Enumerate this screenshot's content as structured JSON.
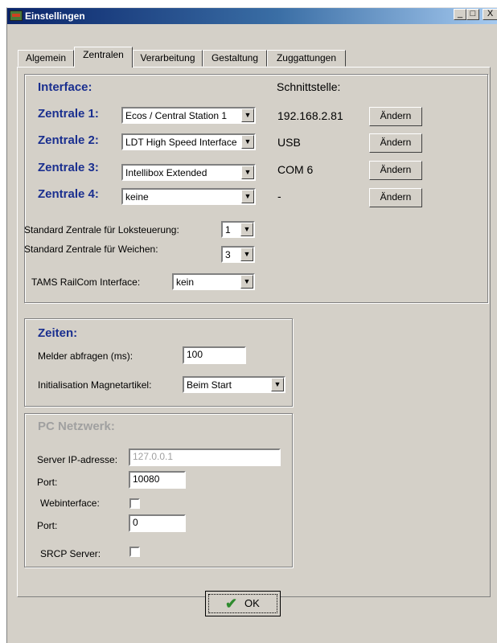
{
  "window": {
    "title": "Einstellingen",
    "minimize": "_",
    "maximize": "□",
    "close": "X"
  },
  "tabs": [
    "Algemein",
    "Zentralen",
    "Verarbeitung",
    "Gestaltung",
    "Zuggattungen"
  ],
  "interface": {
    "heading": "Interface:",
    "schnittstelle_heading": "Schnittstelle:",
    "zentralen": [
      {
        "label": "Zentrale 1:",
        "device": "Ecos / Central Station 1",
        "port": "192.168.2.81",
        "button": "Ändern"
      },
      {
        "label": "Zentrale 2:",
        "device": "LDT High Speed Interface",
        "port": "USB",
        "button": "Ändern"
      },
      {
        "label": "Zentrale 3:",
        "device": "Intellibox Extended",
        "port": "COM 6",
        "button": "Ändern"
      },
      {
        "label": "Zentrale 4:",
        "device": "keine",
        "port": "-",
        "button": "Ändern"
      }
    ],
    "standard_lok_label": "Standard Zentrale für Loksteuerung:",
    "standard_lok_value": "1",
    "standard_weichen_label": "Standard Zentrale für Weichen:",
    "standard_weichen_value": "3",
    "tams_label": "TAMS RailCom Interface:",
    "tams_value": "kein"
  },
  "zeiten": {
    "heading": "Zeiten:",
    "melder_label": "Melder abfragen (ms):",
    "melder_value": "100",
    "init_label": "Initialisation Magnetartikel:",
    "init_value": "Beim Start"
  },
  "netzwerk": {
    "heading": "PC Netzwerk:",
    "server_label": "Server IP-adresse:",
    "server_value": "127.0.0.1",
    "port_label": "Port:",
    "port_value": "10080",
    "web_label": "Webinterface:",
    "web_checked": false,
    "port2_label": "Port:",
    "port2_value": "0",
    "srcp_label": "SRCP Server:",
    "srcp_checked": false
  },
  "ok_button": {
    "label": "OK"
  }
}
